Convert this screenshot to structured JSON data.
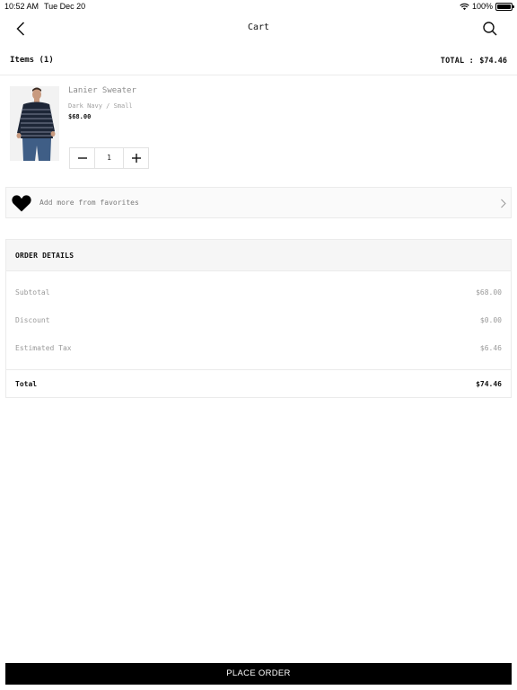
{
  "status_bar": {
    "time": "10:52 AM",
    "date": "Tue Dec 20",
    "battery": "100%",
    "wifi_icon": "wifi-icon",
    "battery_icon": "battery-icon"
  },
  "nav": {
    "title": "Cart",
    "back_icon": "chevron-left-icon",
    "search_icon": "search-icon"
  },
  "items_header": {
    "count_label": "Items (1)",
    "total_label": "TOTAL :",
    "total_value": "$74.46"
  },
  "cart_items": [
    {
      "name": "Lanier Sweater",
      "variant": "Dark Navy / Small",
      "price": "$68.00",
      "quantity": "1",
      "image": "sweater-photo"
    }
  ],
  "favorites": {
    "label": "Add more from favorites",
    "icon": "heart-icon",
    "chevron": "chevron-right-icon"
  },
  "order_details": {
    "title": "ORDER DETAILS",
    "rows": [
      {
        "label": "Subtotal",
        "value": "$68.00"
      },
      {
        "label": "Discount",
        "value": "$0.00"
      },
      {
        "label": "Estimated Tax",
        "value": "$6.46"
      }
    ],
    "total_label": "Total",
    "total_value": "$74.46"
  },
  "place_order_label": "PLACE ORDER",
  "colors": {
    "primary": "#000000",
    "background": "#ffffff",
    "muted_text": "#9a9a9a",
    "border": "#ebebeb"
  }
}
